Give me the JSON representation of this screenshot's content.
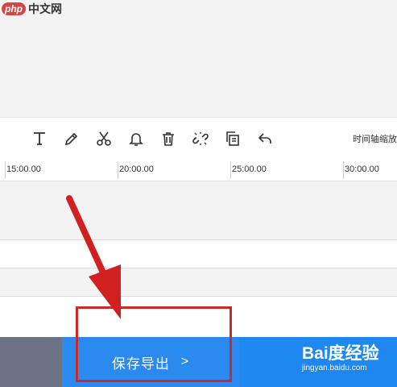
{
  "logo": {
    "badge": "php",
    "text": "中文网"
  },
  "toolbar": {
    "tools": [
      {
        "name": "text-tool",
        "icon": "text-icon"
      },
      {
        "name": "edit-tool",
        "icon": "pencil-icon"
      },
      {
        "name": "cut-tool",
        "icon": "scissors-icon"
      },
      {
        "name": "alert-tool",
        "icon": "bell-icon"
      },
      {
        "name": "delete-tool",
        "icon": "trash-icon"
      },
      {
        "name": "unlink-tool",
        "icon": "unlink-icon"
      },
      {
        "name": "copy-tool",
        "icon": "copy-icon"
      },
      {
        "name": "undo-tool",
        "icon": "undo-icon"
      }
    ],
    "zoom_label": "时间轴缩放"
  },
  "ruler": {
    "ticks": [
      "15:00.00",
      "20:00.00",
      "25:00.00",
      "30:00.00"
    ]
  },
  "bottom": {
    "save_label": "保存导出",
    "chevron": ">"
  },
  "watermark": {
    "main": "Bai度经验",
    "sub": "jingyan.baidu.com"
  },
  "colors": {
    "accent": "#2b8af0",
    "annotation": "#cc2a2a",
    "bottom_left": "#6a7283"
  }
}
